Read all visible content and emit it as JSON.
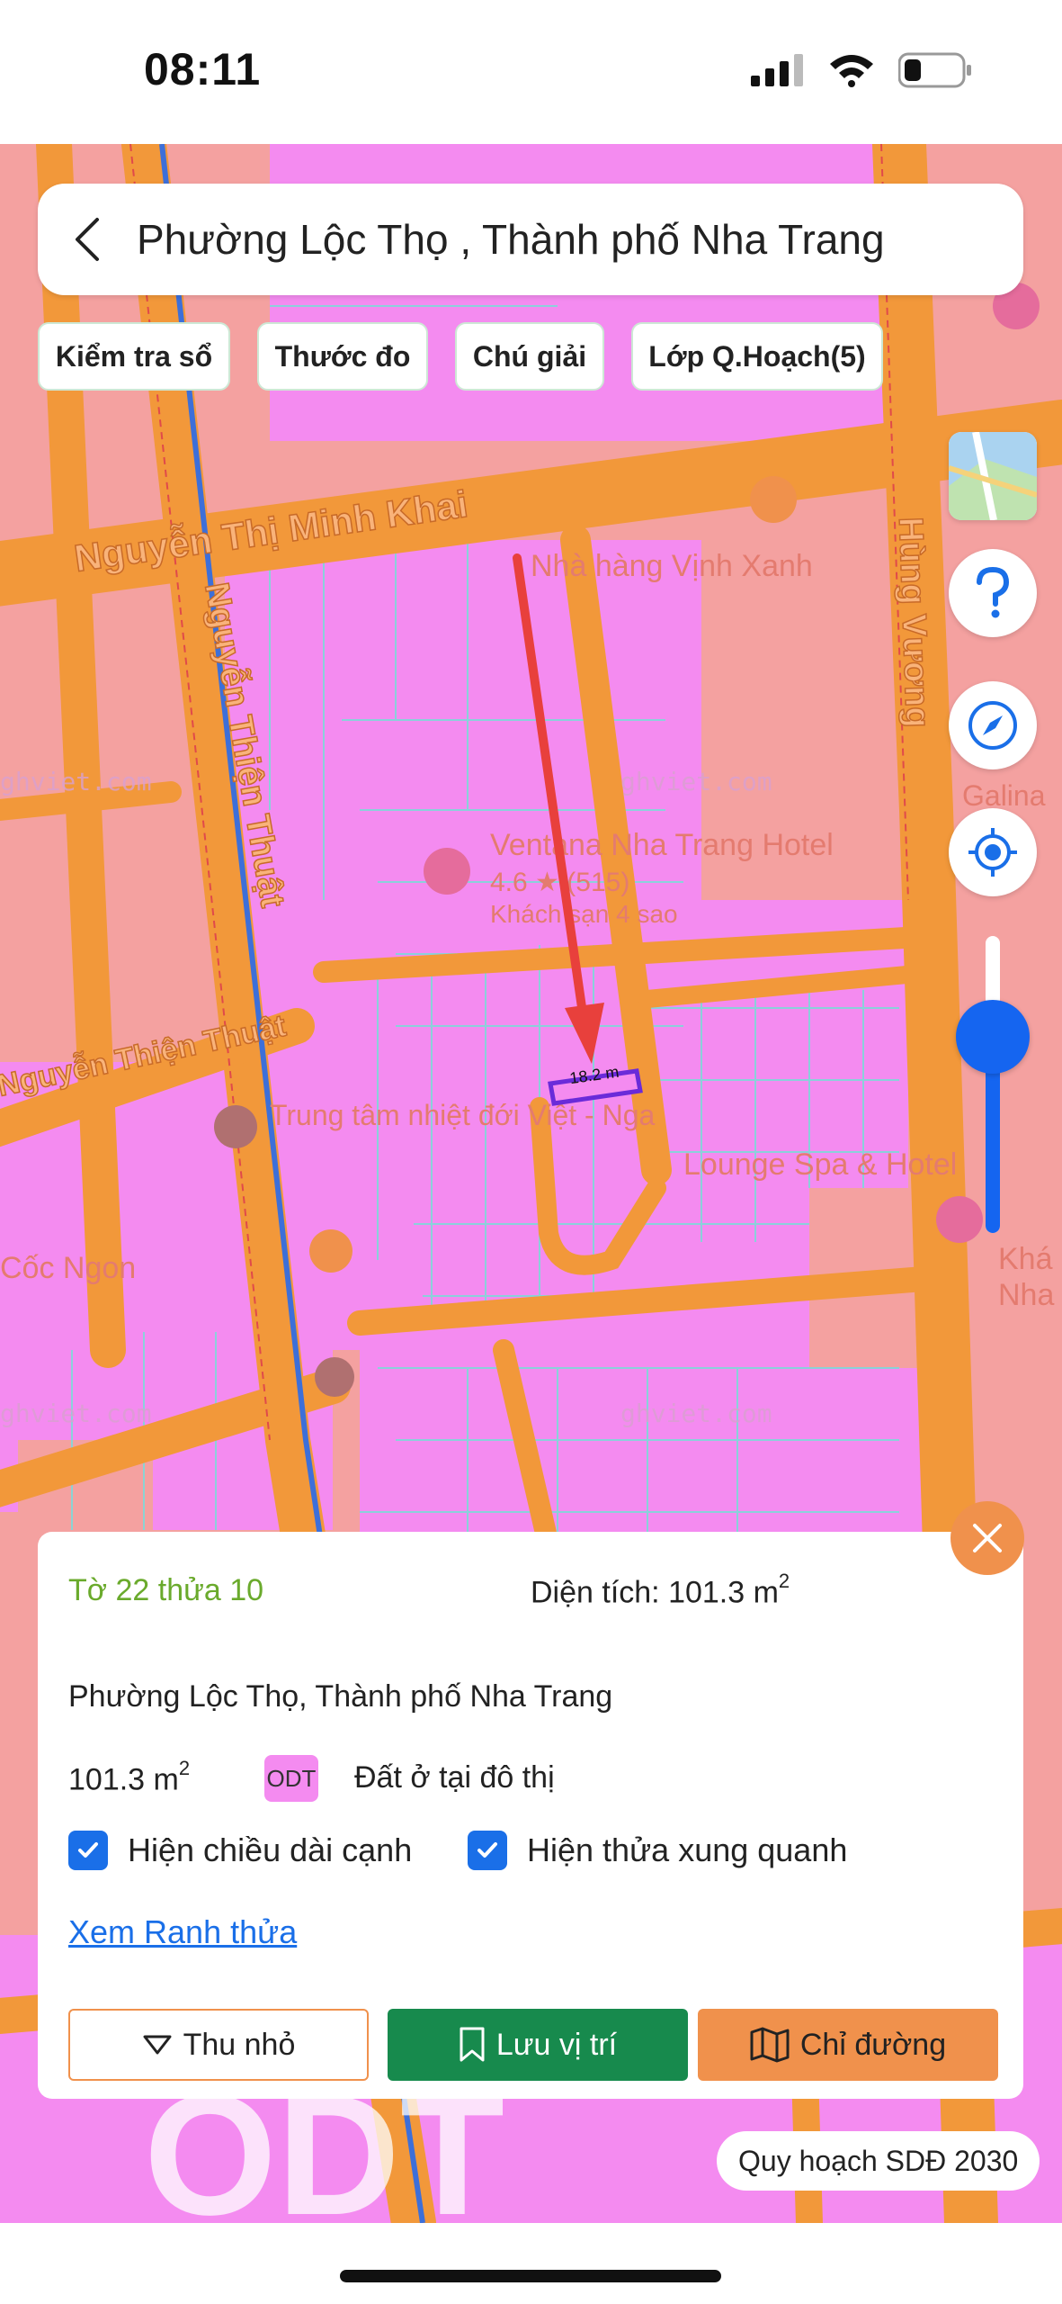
{
  "status_bar": {
    "time": "08:11",
    "battery_level": 0.3
  },
  "header": {
    "title": "Phường Lộc Thọ , Thành phố Nha Trang"
  },
  "chips": [
    "Kiểm tra sổ",
    "Thước đo",
    "Chú giải",
    "Lớp Q.Hoạch(5)"
  ],
  "map": {
    "street_labels": [
      "Nguyễn Thị Minh Khai",
      "Nguyễn Thiện Thuật",
      "Hùng Vương",
      "Nguyễn Thiện Thuật"
    ],
    "poi_labels": [
      "Nhà hàng Vịnh Xanh",
      "Ventana Nha Trang Hotel",
      "4.6 ★ (515)",
      "Khách sạn 4 sao",
      "Trung tâm nhiệt đới Việt - Nga",
      "Lounge Spa & Hotel",
      "Galina",
      "Cốc Ngon",
      "Khá",
      "Nha"
    ],
    "watermarks": [
      "ghviet.com",
      "ghviet.com",
      "ghviet.com",
      "ghviet.com"
    ],
    "measurement": "18.2 m",
    "zone_label": "ODT",
    "zoom_level": 0.66
  },
  "colors": {
    "land_residential": "#f48bf0",
    "road": "#f2983a",
    "background": "#f4a1a0",
    "accent_green": "#178a4d",
    "accent_orange": "#f0914c",
    "accent_blue": "#1565f0"
  },
  "panel": {
    "parcel_id": "Tờ 22 thửa 10",
    "area_label": "Diện tích: 101.3 m",
    "area_unit_sup": "2",
    "address": "Phường Lộc Thọ, Thành phố Nha Trang",
    "area_value": "101.3 m",
    "land_code": "ODT",
    "land_use": "Đất ở tại đô thị",
    "show_edge_length": "Hiện chiều dài cạnh",
    "show_surrounding": "Hiện thửa xung quanh",
    "view_boundary": "Xem Ranh thửa",
    "btn_shrink": "Thu nhỏ",
    "btn_save": "Lưu vị trí",
    "btn_direction": "Chỉ đường"
  },
  "plan_label": "Quy hoạch SDĐ 2030"
}
